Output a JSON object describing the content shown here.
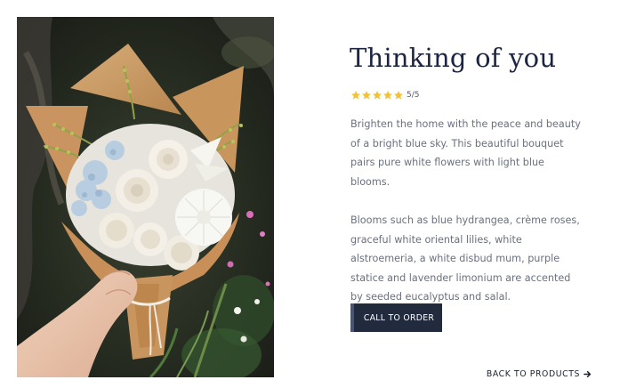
{
  "product": {
    "image_alt": "bouquet-photo",
    "title": "Thinking of you",
    "rating": {
      "stars": 5,
      "max": 5,
      "label": "5/5",
      "star_color": "#f2c230"
    },
    "description": [
      "Brighten the home with the peace and beauty of a bright blue sky. This beautiful bouquet pairs pure white flowers with light blue blooms.",
      "Blooms such as blue hydrangea, crème roses, graceful white oriental lilies, white alstroemeria, a white disbud mum, purple statice and lavender limonium are accented by seeded eucalyptus and salal."
    ],
    "cta_label": "CALL TO ORDER"
  },
  "nav": {
    "back_label": "BACK TO PRODUCTS",
    "back_icon": "arrow-right-icon"
  },
  "colors": {
    "title": "#1c2540",
    "body_text": "#6a7080",
    "button_bg": "#222b3d",
    "button_accent": "#4a5670"
  }
}
